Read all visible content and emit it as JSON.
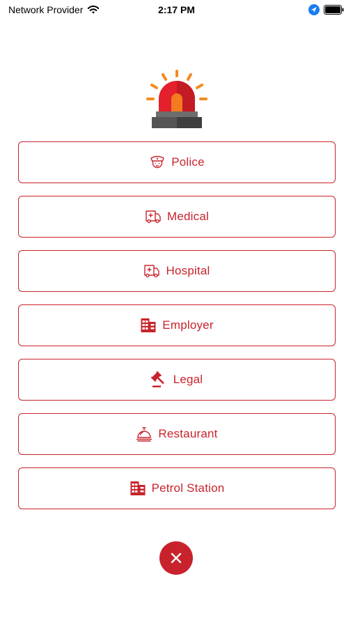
{
  "status_bar": {
    "carrier": "Network Provider",
    "time": "2:17 PM"
  },
  "header": {
    "icon": "siren-icon"
  },
  "buttons": [
    {
      "label": "Police",
      "icon": "police-officer-icon"
    },
    {
      "label": "Medical",
      "icon": "ambulance-icon"
    },
    {
      "label": "Hospital",
      "icon": "ambulance-icon"
    },
    {
      "label": "Employer",
      "icon": "building-icon"
    },
    {
      "label": "Legal",
      "icon": "gavel-icon"
    },
    {
      "label": "Restaurant",
      "icon": "service-bell-icon"
    },
    {
      "label": "Petrol Station",
      "icon": "building-icon"
    }
  ],
  "close_button": {
    "icon": "close-icon"
  },
  "colors": {
    "accent": "#c8232c"
  }
}
